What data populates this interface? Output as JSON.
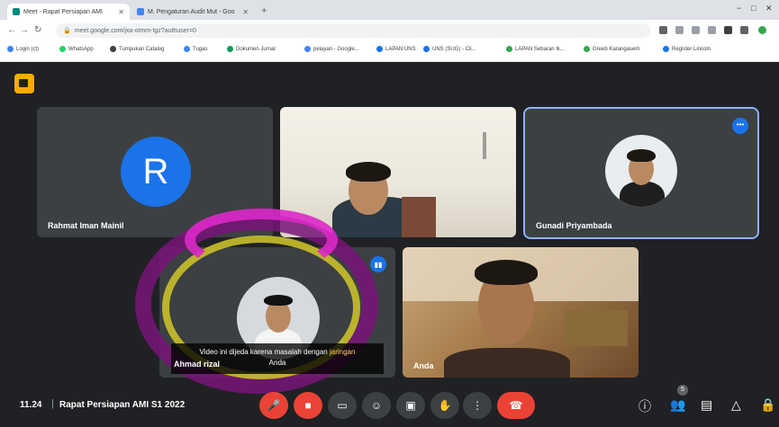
{
  "browser": {
    "tabs": [
      {
        "label": "Meet - Rapat Persiapan AMI",
        "active": true
      },
      {
        "label": "M. Pengaturan Audit Mut - Goo",
        "active": false
      }
    ],
    "new_tab": "+",
    "window_controls": {
      "min": "−",
      "max": "□",
      "close": "✕"
    },
    "url": "meet.google.com/jxa-otmm-tgz?authuser=0",
    "bookmarks": [
      "Login (ct)",
      "WhatsApp",
      "Tumpukan Catalog",
      "Tugas",
      "Dokumen Jurnal",
      "pelayan - Google...",
      "LAPAN UNS",
      "UNS (SUG) - Cli...",
      "LAPAN Sebaran Ik...",
      "Greeb Karangasem",
      "Register Lincoln"
    ],
    "colors": {
      "active_tab": "#ffffff",
      "strip": "#dee1e6"
    }
  },
  "meet": {
    "participants": [
      {
        "name": "Rahmat Iman Mainil",
        "avatar_letter": "R",
        "camera": false
      },
      {
        "name": "",
        "camera": true
      },
      {
        "name": "Gunadi Priyambada",
        "camera": false,
        "active_speaker": true
      },
      {
        "name": "Ahmad rizal",
        "camera": false
      },
      {
        "name": "Anda",
        "camera": true
      }
    ],
    "caption": {
      "text": "Video ini dijeda karena masalah dengan",
      "highlight": "jaringan",
      "subtext": "Anda"
    },
    "footer": {
      "time": "11.24",
      "separator": "|",
      "meeting_title": "Rapat Persiapan AMI S1 2022"
    },
    "controls": [
      "mic-icon",
      "camera-icon",
      "captions-icon",
      "reactions-icon",
      "present-icon",
      "hand-icon",
      "more-icon",
      "end-call-icon"
    ],
    "right_controls": [
      "info-icon",
      "people-icon",
      "chat-icon",
      "activities-icon",
      "lock-icon"
    ],
    "participant_count": "5",
    "more_dots": "•••",
    "colors": {
      "accent": "#1a73e8",
      "end_call": "#ea4335",
      "bg": "#202124",
      "tile": "#3c4043"
    }
  }
}
